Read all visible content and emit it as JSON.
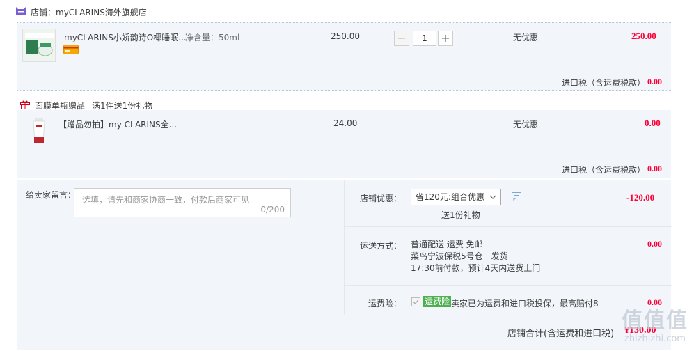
{
  "shop": {
    "label": "店铺：myCLARINS海外旗舰店"
  },
  "items": [
    {
      "title": "myCLARINS小娇韵诗O椰睡眠...",
      "spec_label": "净含量：50ml",
      "unit_price": "250.00",
      "quantity": "1",
      "discount": "无优惠",
      "subtotal": "250.00",
      "tax_label": "进口税（含运费税款）",
      "tax_value": "0.00"
    },
    {
      "title": "【赠品勿拍】my CLARINS全...",
      "unit_price": "24.00",
      "discount": "无优惠",
      "subtotal": "0.00",
      "tax_label": "进口税（含运费税款）",
      "tax_value": "0.00"
    }
  ],
  "gift_header": {
    "name": "面膜单瓶赠品",
    "rule": "满1件送1份礼物"
  },
  "message": {
    "label": "给卖家留言：",
    "placeholder": "选填，请先和商家协商一致，付款后商家可见",
    "counter": "0/200"
  },
  "shop_discount": {
    "label": "店铺优惠：",
    "selected": "省120元:组合优惠",
    "note": "送1份礼物",
    "value": "-120.00"
  },
  "shipping": {
    "label": "运送方式：",
    "line1": "普通配送 运费 免邮",
    "line2": "菜鸟宁波保税5号仓　发货",
    "line3": "17:30前付款，预计4天内送货上门",
    "value": "0.00"
  },
  "insurance": {
    "label": "运费险：",
    "badge": "运费险",
    "text": "卖家已为运费和进口税投保，最高赔付8",
    "value": "0.00"
  },
  "total": {
    "label": "店铺合计(含运费和进口税)",
    "value": "¥130.00"
  },
  "watermark": {
    "main": "值值值",
    "sub": "zhizhizhi.com"
  },
  "colors": {
    "accent_red": "#ff0036",
    "row_bg": "#f2f6fb",
    "badge_green": "#4caf50"
  }
}
